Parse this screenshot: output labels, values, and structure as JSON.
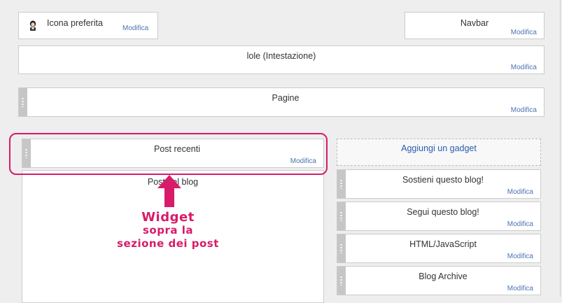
{
  "layout": {
    "favicon": {
      "title": "Icona preferita",
      "edit": "Modifica"
    },
    "navbar": {
      "title": "Navbar",
      "edit": "Modifica"
    },
    "header": {
      "title": "lole (Intestazione)",
      "edit": "Modifica"
    },
    "pages": {
      "title": "Pagine",
      "edit": "Modifica"
    },
    "recent_posts": {
      "title": "Post recenti",
      "edit": "Modifica"
    },
    "blog_posts": {
      "title": "Post del blog"
    },
    "sidebar": {
      "add_gadget": "Aggiungi un gadget",
      "gadgets": [
        {
          "title": "Sostieni questo blog!",
          "edit": "Modifica"
        },
        {
          "title": "Segui questo blog!",
          "edit": "Modifica"
        },
        {
          "title": "HTML/JavaScript",
          "edit": "Modifica"
        },
        {
          "title": "Blog Archive",
          "edit": "Modifica"
        }
      ]
    }
  },
  "annotation": {
    "line1": "Widget",
    "line2": "sopra la",
    "line3": "sezione dei post"
  },
  "colors": {
    "accent": "#d81b6a",
    "link": "#4d74b0",
    "add_gadget": "#2a5db0"
  },
  "icons": {
    "favicon": "avatar-icon",
    "handle": "drag-handle-icon",
    "arrow": "up-arrow-icon"
  }
}
